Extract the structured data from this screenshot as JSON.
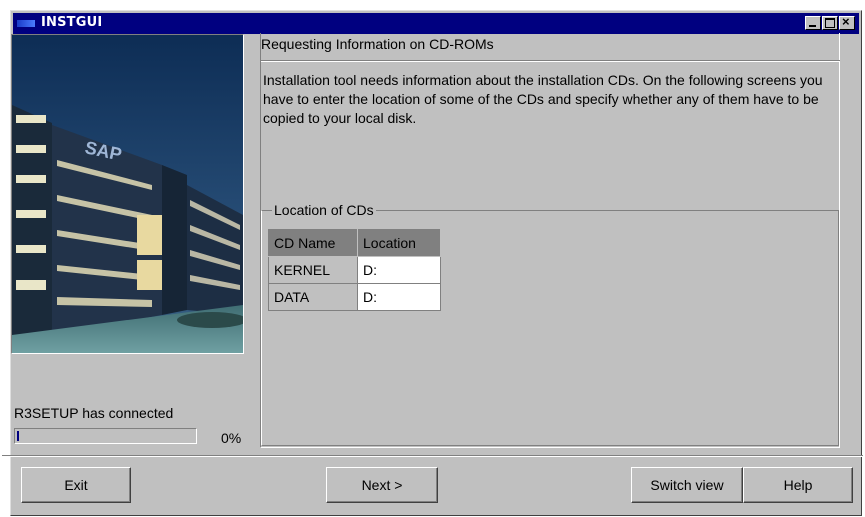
{
  "window": {
    "title": "INSTGUI"
  },
  "left": {
    "status_text": "R3SETUP has connected",
    "progress": {
      "value": 0.0,
      "label": "0%"
    }
  },
  "main": {
    "heading": "Requesting Information on CD-ROMs",
    "description": "Installation tool needs information about the installation CDs. On the following screens you have to enter the location of some of the CDs and specify whether any of them have to be copied to your local disk.",
    "group_label": "Location of CDs",
    "table": {
      "headers": [
        "CD Name",
        "Location"
      ],
      "rows": [
        [
          "KERNEL",
          "D:"
        ],
        [
          "DATA",
          "D:"
        ]
      ]
    }
  },
  "buttons": {
    "exit": "Exit",
    "next": "Next >",
    "switch_view": "Switch view",
    "help": "Help"
  },
  "photo": {
    "sign_text": "SAP"
  },
  "colors": {
    "titlebar": "#000080",
    "face": "#c0c0c0",
    "progress": "#000080"
  }
}
